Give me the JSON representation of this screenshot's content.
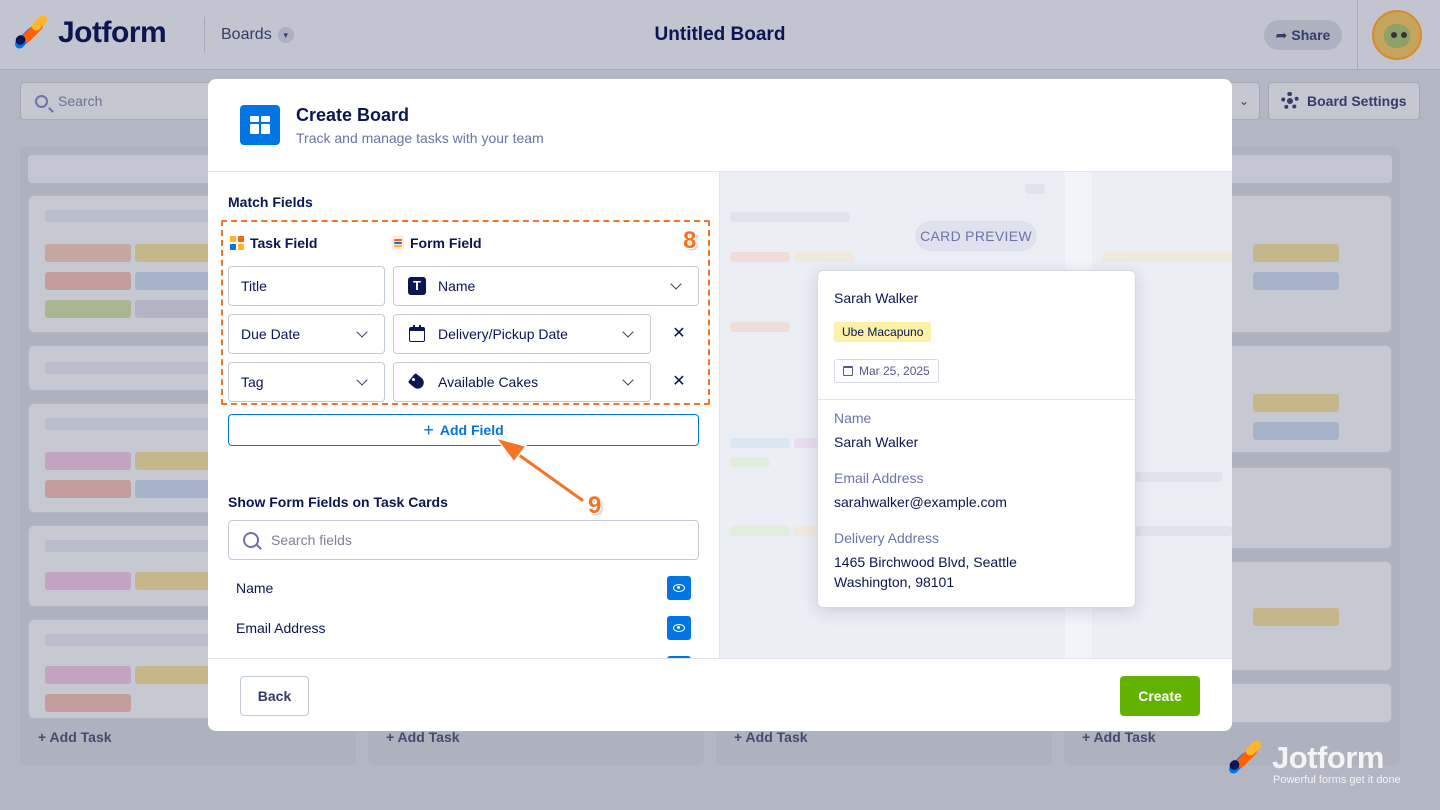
{
  "app": {
    "logo_text": "Jotform",
    "boards_menu_label": "Boards",
    "board_title": "Untitled Board",
    "share_label": "Share",
    "search_placeholder": "Search",
    "board_settings_label": "Board Settings",
    "add_task_label": "Add Task",
    "watermark_brand": "Jotform",
    "watermark_tagline": "Powerful forms get it done",
    "brand_colors": {
      "blue": "#0075e3",
      "green": "#64b200",
      "orange": "#f27424",
      "navy": "#0a1551"
    }
  },
  "modal": {
    "title": "Create Board",
    "subtitle": "Track and manage tasks with your team",
    "match_fields_title": "Match Fields",
    "task_field_header": "Task Field",
    "form_field_header": "Form Field",
    "annotation_step_8": "8",
    "annotation_step_9": "9",
    "mappings": [
      {
        "task_field": "Title",
        "form_field": "Name",
        "form_icon": "text-type-icon",
        "removable": false
      },
      {
        "task_field": "Due Date",
        "form_field": "Delivery/Pickup Date",
        "form_icon": "calendar-icon",
        "removable": true
      },
      {
        "task_field": "Tag",
        "form_field": "Available Cakes",
        "form_icon": "tag-icon",
        "removable": true
      }
    ],
    "remove_symbol": "✕",
    "add_field_label": "Add Field",
    "show_fields_title": "Show Form Fields on Task Cards",
    "search_fields_placeholder": "Search fields",
    "visible_fields": [
      {
        "label": "Name",
        "visible": true
      },
      {
        "label": "Email Address",
        "visible": true
      }
    ],
    "back_label": "Back",
    "create_label": "Create"
  },
  "preview": {
    "pill_label": "CARD PREVIEW",
    "card_title": "Sarah Walker",
    "tag": "Ube Macapuno",
    "date": "Mar 25, 2025",
    "fields": [
      {
        "label": "Name",
        "value_lines": [
          "Sarah Walker"
        ]
      },
      {
        "label": "Email Address",
        "value_lines": [
          "sarahwalker@example.com"
        ]
      },
      {
        "label": "Delivery Address",
        "value_lines": [
          "1465 Birchwood Blvd, Seattle",
          "Washington, 98101"
        ]
      }
    ]
  }
}
